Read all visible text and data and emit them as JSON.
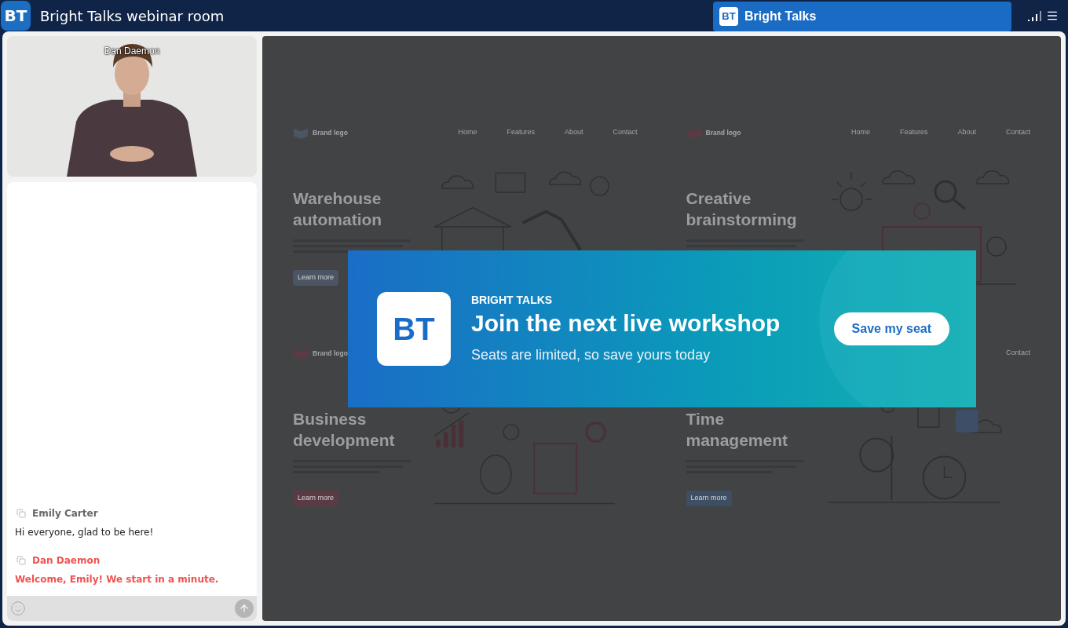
{
  "header": {
    "logo": "BT",
    "title": "Bright Talks webinar room",
    "tab": {
      "logo": "BT",
      "label": "Bright Talks"
    }
  },
  "video": {
    "name": "Dan Daemon"
  },
  "chat": {
    "messages": [
      {
        "author": "Emily Carter",
        "text": "Hi everyone, glad to be here!",
        "kind": "guest"
      },
      {
        "author": "Dan Daemon",
        "text": "Welcome, Emily! We start in a minute.",
        "kind": "host"
      }
    ]
  },
  "slides": [
    {
      "brand": "Brand logo",
      "nav": [
        "Home",
        "Features",
        "About",
        "Contact"
      ],
      "heading": "Warehouse automation",
      "button": "Learn more",
      "color": "#4b5563",
      "kind": "warehouse"
    },
    {
      "brand": "Brand logo",
      "nav": [
        "Home",
        "Features",
        "About",
        "Contact"
      ],
      "heading": "Creative brainstorming",
      "color": "#5b3a44",
      "kind": "ideas"
    },
    {
      "brand": "Brand logo",
      "heading": "Business development",
      "button": "Learn more",
      "color": "#5b3a44",
      "kind": "growth"
    },
    {
      "nav": [
        "Contact"
      ],
      "heading": "Time management",
      "button": "Learn more",
      "color": "#3f4f63",
      "kind": "time"
    }
  ],
  "banner": {
    "logo": "BT",
    "eyebrow": "BRIGHT TALKS",
    "title": "Join the next live workshop",
    "subtitle": "Seats are limited, so save yours today",
    "button": "Save my seat"
  }
}
